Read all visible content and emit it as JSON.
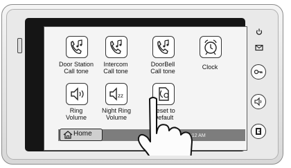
{
  "screen": {
    "tiles": [
      {
        "label_line1": "Door Station",
        "label_line2": "Call tone",
        "icon": "phone-music-icon"
      },
      {
        "label_line1": "Intercom",
        "label_line2": "Call tone",
        "icon": "phone-music-icon"
      },
      {
        "label_line1": "DoorBell",
        "label_line2": "Call tone",
        "icon": "phone-music-icon"
      },
      {
        "label_line1": "Clock",
        "label_line2": "",
        "icon": "alarm-clock-icon"
      },
      {
        "label_line1": "Ring",
        "label_line2": "Volume",
        "icon": "speaker-volume-icon"
      },
      {
        "label_line1": "Night Ring",
        "label_line2": "Volume",
        "icon": "speaker-sleep-icon"
      },
      {
        "label_line1": "Reset to",
        "label_line2": "Default",
        "icon": "reset-document-icon"
      }
    ],
    "status_bar": {
      "home_label": "Home",
      "home_icon": "house-icon",
      "datetime": "2011 Fri.10:12 AM"
    }
  },
  "hardware_buttons": [
    {
      "icon": "power-icon"
    },
    {
      "icon": "envelope-icon"
    },
    {
      "icon": "key-icon"
    },
    {
      "icon": "speaker-icon"
    },
    {
      "icon": "door-unlock-icon"
    }
  ],
  "colors": {
    "screen_bg": "#f4f4f4",
    "bezel": "#151515",
    "status_bar": "#7d7d7d"
  }
}
